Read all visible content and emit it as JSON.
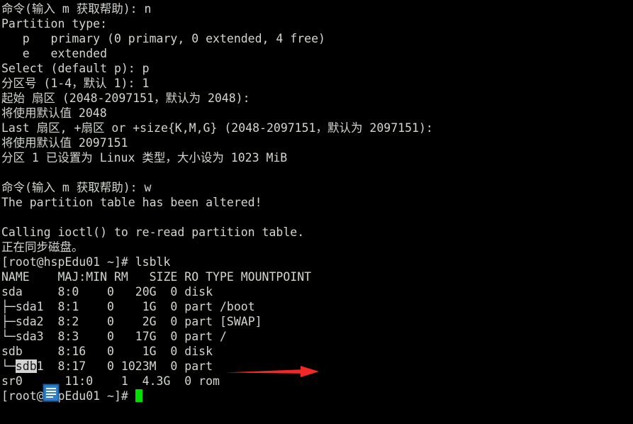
{
  "terminal": {
    "background_color": "#000000",
    "text_color": "#d3d7cf",
    "cursor_color": "#00e000",
    "selection_bg_color": "#d4d4d4",
    "selection_fg_color": "#1a1a1a",
    "arrow_color": "#f02828",
    "icon_color": "#2e7fd0",
    "lines": [
      "命令(输入 m 获取帮助): n",
      "Partition type:",
      "   p   primary (0 primary, 0 extended, 4 free)",
      "   e   extended",
      "Select (default p): p",
      "分区号 (1-4，默认 1): 1",
      "起始 扇区 (2048-2097151，默认为 2048):",
      "将使用默认值 2048",
      "Last 扇区, +扇区 or +size{K,M,G} (2048-2097151，默认为 2097151):",
      "将使用默认值 2097151",
      "分区 1 已设置为 Linux 类型，大小设为 1023 MiB",
      "",
      "命令(输入 m 获取帮助): w",
      "The partition table has been altered!",
      "",
      "Calling ioctl() to re-read partition table.",
      "正在同步磁盘。"
    ],
    "prompt_lsblk": "[root@hspEdu01 ~]# lsblk",
    "lsblk_header": "NAME    MAJ:MIN RM   SIZE RO TYPE MOUNTPOINT",
    "lsblk_rows": [
      {
        "tree": "",
        "name": "sda",
        "rest": "     8:0    0   20G  0 disk "
      },
      {
        "tree": "├─",
        "name": "sda1",
        "rest": "  8:1    0    1G  0 part /boot"
      },
      {
        "tree": "├─",
        "name": "sda2",
        "rest": "  8:2    0    2G  0 part [SWAP]"
      },
      {
        "tree": "└─",
        "name": "sda3",
        "rest": "  8:3    0   17G  0 part /"
      },
      {
        "tree": "",
        "name": "sdb",
        "rest": "     8:16   0    1G  0 disk "
      }
    ],
    "sdb1_row": {
      "tree": "└─",
      "name_selected": "sdb",
      "name_rest": "1",
      "rest": "  8:17   0 1023M  0 part "
    },
    "sr0_row": "sr0      11:0    1  4.3G  0 rom  ",
    "prompt_final": "[root@hspEdu01 ~]# ",
    "annotations": {
      "red_arrow_label": "red-pointer-arrow",
      "doc_icon_label": "blue-document-icon"
    }
  }
}
